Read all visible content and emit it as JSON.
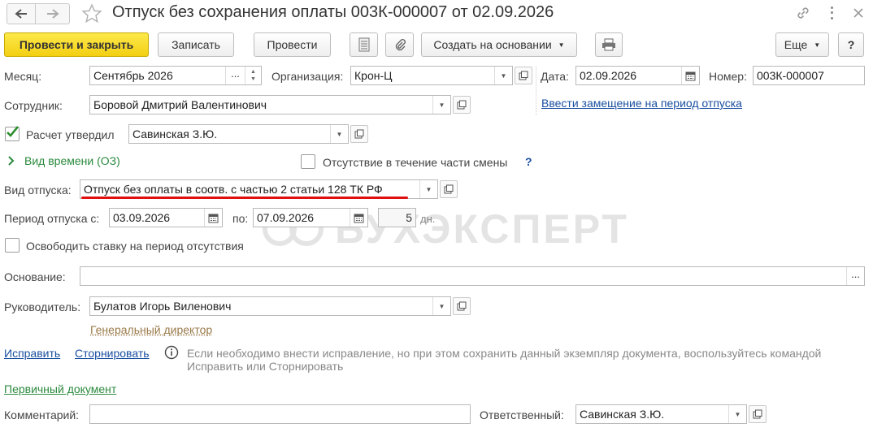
{
  "title": "Отпуск без сохранения оплаты 003К-000007 от 02.09.2026",
  "toolbar": {
    "post_close": "Провести и закрыть",
    "save": "Записать",
    "post": "Провести",
    "create_based": "Создать на основании",
    "more": "Еще",
    "help": "?"
  },
  "month": {
    "label": "Месяц:",
    "value": "Сентябрь 2026",
    "picker": "..."
  },
  "organization": {
    "label": "Организация:",
    "value": "Крон-Ц"
  },
  "date": {
    "label": "Дата:",
    "value": "02.09.2026"
  },
  "number": {
    "label": "Номер:",
    "value": "003К-000007"
  },
  "employee": {
    "label": "Сотрудник:",
    "value": "Боровой Дмитрий Валентинович"
  },
  "substitute_link": "Ввести замещение на период отпуска",
  "approved": {
    "label": "Расчет утвердил",
    "value": "Савинская З.Ю.",
    "checked": true
  },
  "time_type": {
    "label": "Вид времени (ОЗ)"
  },
  "partial_shift": {
    "label": "Отсутствие в течение части смены",
    "help": "?"
  },
  "leave_type": {
    "label": "Вид отпуска:",
    "value": "Отпуск без оплаты в соотв. с частью 2 статьи 128 ТК РФ"
  },
  "period": {
    "label": "Период отпуска с:",
    "from": "03.09.2026",
    "to_label": "по:",
    "to": "07.09.2026",
    "days": "5",
    "days_unit": "дн."
  },
  "release_rate": {
    "label": "Освободить ставку на период отсутствия"
  },
  "basis": {
    "label": "Основание:",
    "value": "",
    "picker": "..."
  },
  "manager": {
    "label": "Руководитель:",
    "value": "Булатов Игорь Виленович",
    "position": "Генеральный директор"
  },
  "correct_link": "Исправить",
  "reverse_link": "Сторнировать",
  "info_line1": "Если необходимо внести исправление, но при этом сохранить данный экземпляр документа, воспользуйтесь командой",
  "info_line2": "Исправить или Сторнировать",
  "primary_doc": "Первичный документ",
  "comment": {
    "label": "Комментарий:",
    "value": ""
  },
  "responsible": {
    "label": "Ответственный:",
    "value": "Савинская З.Ю."
  },
  "watermark": "БУХЭКСПЕРТ",
  "colors": {
    "primary_button": "#f5d31a",
    "link": "#1a4fa0",
    "green_link": "#2b8a3e",
    "underline": "#e01010",
    "watermark": "#e6e6e6"
  }
}
